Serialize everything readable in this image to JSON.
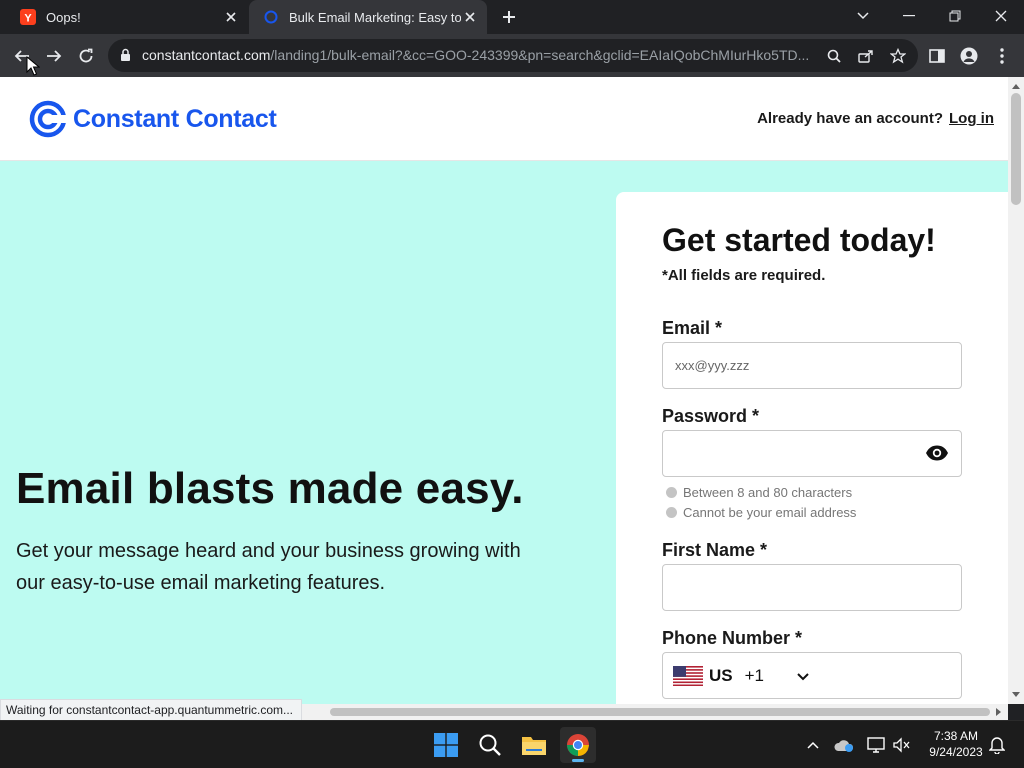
{
  "browser": {
    "tabs": [
      {
        "title": "Oops!",
        "favicon": "yandex-icon",
        "active": false
      },
      {
        "title": "Bulk Email Marketing: Easy to use",
        "favicon": "constant-contact-icon",
        "active": true
      }
    ],
    "url_host": "constantcontact.com",
    "url_path": "/landing1/bulk-email?&cc=GOO-243399&pn=search&gclid=EAIaIQobChMIurHko5TD...",
    "status_text": "Waiting for constantcontact-app.quantummetric.com..."
  },
  "site": {
    "brand": "Constant Contact",
    "already_text": "Already have an account?",
    "login_label": "Log in"
  },
  "hero": {
    "title": "Email blasts made easy.",
    "subtitle": "Get your message heard and your business growing with our easy-to-use email marketing features."
  },
  "form": {
    "title": "Get started today!",
    "required_note": "*All fields are required.",
    "email_label": "Email *",
    "email_placeholder": "xxx@yyy.zzz",
    "password_label": "Password *",
    "hint_length": "Between 8 and 80 characters",
    "hint_email": "Cannot be your email address",
    "first_name_label": "First Name *",
    "phone_label": "Phone Number *",
    "phone_country": "US",
    "phone_code": "+1"
  },
  "taskbar": {
    "time": "7:38 AM",
    "date": "9/24/2023"
  },
  "colors": {
    "brand_blue": "#1856ed",
    "hero_bg": "#bdfbf1"
  }
}
